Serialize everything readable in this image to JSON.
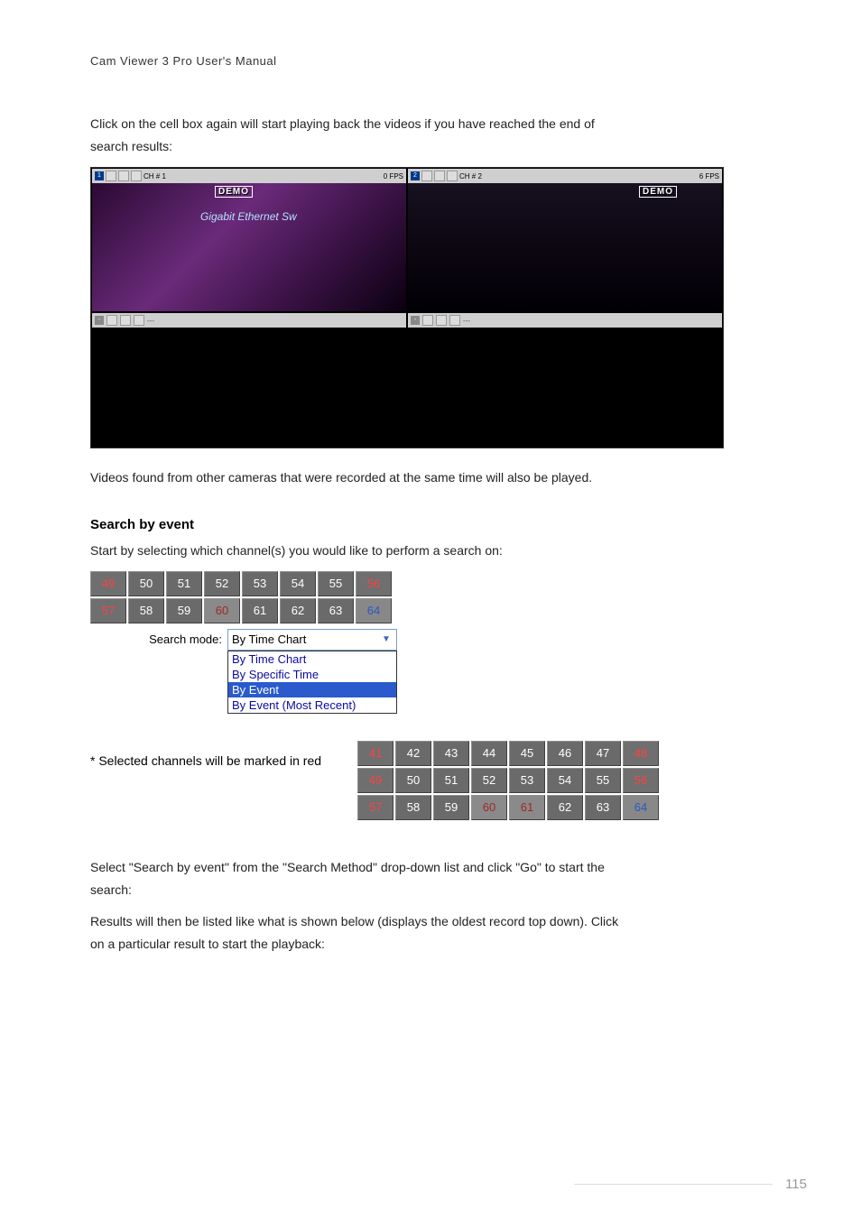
{
  "header": "Cam  Viewer  3  Pro  User's  Manual",
  "para1a": "Click on the cell box again will start playing back the videos if you have reached the end of",
  "para1b": "search results:",
  "cell1": {
    "num": "1",
    "label": "CH # 1",
    "fpsText": "0 FPS",
    "demo": "DEMO",
    "overlay": "Gigabit Ethernet Sw"
  },
  "cell2": {
    "num": "2",
    "label": "CH # 2",
    "fpsText": "6 FPS",
    "demo": "DEMO"
  },
  "emptybar": {
    "num": "-",
    "dash": "---"
  },
  "para2": "Videos found from other cameras that were recorded at the same time will also be played.",
  "sectionTitle": "Search by event",
  "para3": "Start by selecting which channel(s) you would like to perform a search on:",
  "grid1": {
    "rows": [
      [
        {
          "n": "49",
          "c": "lred"
        },
        {
          "n": "50"
        },
        {
          "n": "51"
        },
        {
          "n": "52"
        },
        {
          "n": "53"
        },
        {
          "n": "54"
        },
        {
          "n": "55"
        },
        {
          "n": "56",
          "c": "lred"
        }
      ],
      [
        {
          "n": "57",
          "c": "lred"
        },
        {
          "n": "58"
        },
        {
          "n": "59"
        },
        {
          "n": "60",
          "c": "dred"
        },
        {
          "n": "61"
        },
        {
          "n": "62"
        },
        {
          "n": "63"
        },
        {
          "n": "64",
          "c": "blue"
        }
      ]
    ]
  },
  "searchModeLabel": "Search mode:",
  "comboSelected": "By Time Chart",
  "comboOptions": {
    "o1": "By Time Chart",
    "o2": "By Specific Time",
    "o3": "By Event",
    "o4": "By Event (Most Recent)"
  },
  "note": "* Selected channels will be marked in red",
  "grid2": {
    "rows": [
      [
        {
          "n": "41",
          "c": "lred"
        },
        {
          "n": "42"
        },
        {
          "n": "43"
        },
        {
          "n": "44"
        },
        {
          "n": "45"
        },
        {
          "n": "46"
        },
        {
          "n": "47"
        },
        {
          "n": "48",
          "c": "lred"
        }
      ],
      [
        {
          "n": "49",
          "c": "lred"
        },
        {
          "n": "50"
        },
        {
          "n": "51"
        },
        {
          "n": "52"
        },
        {
          "n": "53"
        },
        {
          "n": "54"
        },
        {
          "n": "55"
        },
        {
          "n": "56",
          "c": "lred"
        }
      ],
      [
        {
          "n": "57",
          "c": "lred"
        },
        {
          "n": "58"
        },
        {
          "n": "59"
        },
        {
          "n": "60",
          "c": "dred"
        },
        {
          "n": "61",
          "c": "dred"
        },
        {
          "n": "62"
        },
        {
          "n": "63"
        },
        {
          "n": "64",
          "c": "blue"
        }
      ]
    ]
  },
  "para4a": "Select \"Search by event\" from the \"Search Method\" drop-down list and click \"Go\" to start the",
  "para4b": "search:",
  "para5a": "Results will then be listed like what is shown below (displays the oldest record top down). Click",
  "para5b": "on a particular result to start the playback:",
  "pageNumber": "115"
}
